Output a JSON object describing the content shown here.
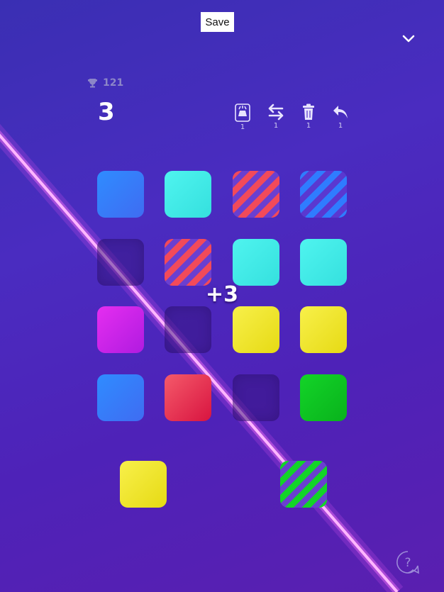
{
  "toolbar": {
    "save_label": "Save"
  },
  "stats": {
    "best": "121",
    "score": "3"
  },
  "tools": [
    {
      "name": "magic-hat",
      "count": "1"
    },
    {
      "name": "swap",
      "count": "1"
    },
    {
      "name": "trash",
      "count": "1"
    },
    {
      "name": "undo",
      "count": "1"
    }
  ],
  "board": {
    "rows": [
      [
        "blue",
        "cyan",
        "striped-red",
        "striped-blue"
      ],
      [
        "empty",
        "striped-red",
        "cyan",
        "cyan"
      ],
      [
        "magenta",
        "empty",
        "yellow",
        "yellow"
      ],
      [
        "blue",
        "red",
        "empty",
        "green"
      ]
    ]
  },
  "next_tiles": [
    "yellow",
    "striped-green"
  ],
  "popup": {
    "bonus": "+3"
  },
  "colors": {
    "blue": "#2f8cff",
    "cyan": "#4ff4ef",
    "yellow": "#f8f04a",
    "magenta": "#e52ef0",
    "red": "#f55a6a",
    "green": "#13d428",
    "laser": "#f07cf2"
  },
  "icons": [
    "trophy-icon",
    "chevron-down-icon",
    "magic-hat-icon",
    "swap-icon",
    "trash-icon",
    "undo-icon",
    "help-icon"
  ]
}
